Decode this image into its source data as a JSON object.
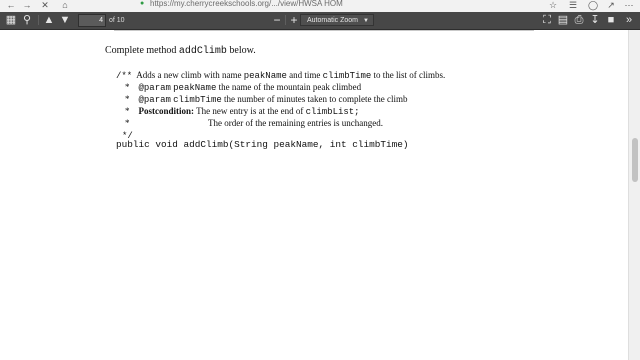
{
  "browser": {
    "url": "https://my.cherrycreekschools.org/.../view/HWSA HOM"
  },
  "toolbar": {
    "current_page": "4",
    "page_count": "of 10",
    "zoom": "Automatic Zoom",
    "zoom_out": "−",
    "zoom_in": "+"
  },
  "document": {
    "instruction_prefix": "Complete method",
    "instruction_method": "addClimb",
    "instruction_suffix": "below.",
    "doc_comment": {
      "open": "/**",
      "line1_a": "Adds a new climb with name",
      "line1_code1": "peakName",
      "line1_b": "and time",
      "line1_code2": "climbTime",
      "line1_c": "to the list of climbs.",
      "star": "*",
      "param1_tag": "@param",
      "param1_name": "peakName",
      "param1_desc": "the name of the mountain peak climbed",
      "param2_tag": "@param",
      "param2_name": "climbTime",
      "param2_desc": "the number of minutes taken to complete the climb",
      "post_label": "Postcondition:",
      "post_desc_a": "The new entry is at the end of",
      "post_code": "climbList;",
      "post_desc2": "The order of the remaining entries is unchanged.",
      "close": "*/"
    },
    "signature": "public void addClimb(String peakName, int climbTime)"
  }
}
